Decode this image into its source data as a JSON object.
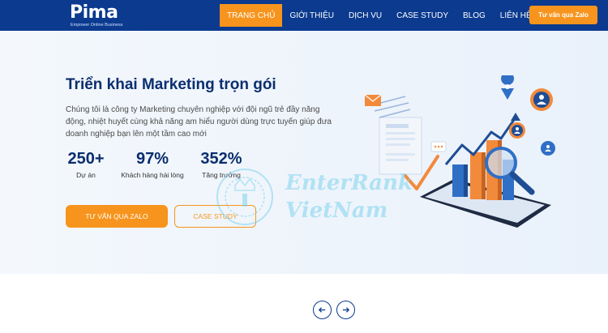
{
  "logo": {
    "name": "Pima",
    "tagline": "Empower Online Business"
  },
  "nav": {
    "items": [
      {
        "label": "TRANG CHỦ",
        "active": true
      },
      {
        "label": "GIỚI THIỆU",
        "active": false
      },
      {
        "label": "DỊCH VỤ",
        "active": false
      },
      {
        "label": "CASE STUDY",
        "active": false
      },
      {
        "label": "BLOG",
        "active": false
      },
      {
        "label": "LIÊN HỆ",
        "active": false
      }
    ],
    "cta": "Tư vấn qua Zalo"
  },
  "hero": {
    "title": "Triển khai Marketing trọn gói",
    "description": "Chúng tôi là công ty Marketing chuyên nghiệp với đội ngũ trẻ đầy năng động, nhiệt huyết cùng khả năng am hiểu người dùng trực tuyến giúp đưa doanh nghiệp bạn lên một tầm cao mới",
    "stats": [
      {
        "value": "250+",
        "label": "Dự án"
      },
      {
        "value": "97%",
        "label": "Khách hàng hài lòng"
      },
      {
        "value": "352%",
        "label": "Tăng trưởng"
      }
    ],
    "primary_button": "TƯ VẤN QUA ZALO",
    "secondary_button": "CASE STUDY"
  },
  "watermark": {
    "line1": "EnterRank",
    "line2": "VietNam"
  },
  "carousel": {
    "prev_icon": "arrow-left-icon",
    "next_icon": "arrow-right-icon"
  },
  "colors": {
    "nav_bg": "#0b3a8f",
    "accent": "#f7941d",
    "title": "#0b2e6f"
  }
}
